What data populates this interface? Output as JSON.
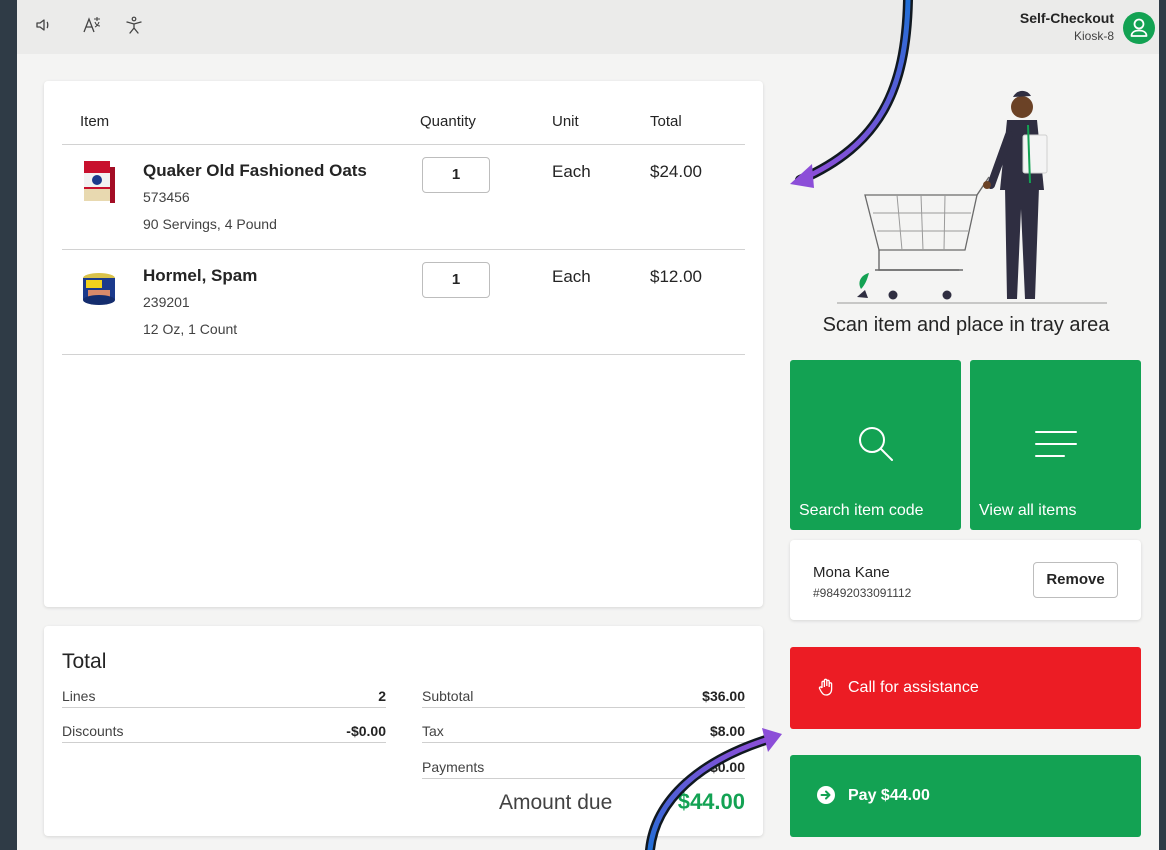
{
  "header": {
    "title": "Self-Checkout",
    "subtitle": "Kiosk-8",
    "icons": [
      "speaker-icon",
      "language-icon",
      "accessibility-icon",
      "user-icon"
    ]
  },
  "table": {
    "columns": [
      "Item",
      "Quantity",
      "Unit",
      "Total"
    ],
    "rows": [
      {
        "name": "Quaker Old Fashioned Oats",
        "code": "573456",
        "description": "90 Servings, 4 Pound",
        "quantity": "1",
        "unit": "Each",
        "total": "$24.00"
      },
      {
        "name": "Hormel, Spam",
        "code": "239201",
        "description": "12 Oz, 1 Count",
        "quantity": "1",
        "unit": "Each",
        "total": "$12.00"
      }
    ]
  },
  "totals": {
    "title": "Total",
    "lines_label": "Lines",
    "lines_value": "2",
    "discounts_label": "Discounts",
    "discounts_value": "-$0.00",
    "subtotal_label": "Subtotal",
    "subtotal_value": "$36.00",
    "tax_label": "Tax",
    "tax_value": "$8.00",
    "payments_label": "Payments",
    "payments_value": "$0.00",
    "amount_due_label": "Amount due",
    "amount_due_value": "$44.00"
  },
  "scan_prompt": "Scan item and place in tray area",
  "tiles": {
    "search_label": "Search item code",
    "view_all_label": "View all items"
  },
  "member": {
    "name": "Mona Kane",
    "id": "#98492033091112",
    "remove_label": "Remove"
  },
  "actions": {
    "assist_label": "Call for assistance",
    "pay_label": "Pay $44.00"
  },
  "colors": {
    "brand_green": "#13a253",
    "alert_red": "#ec1c24",
    "annotation_arrow_start": "#1f6fd6",
    "annotation_arrow_end": "#8c4ed8"
  }
}
